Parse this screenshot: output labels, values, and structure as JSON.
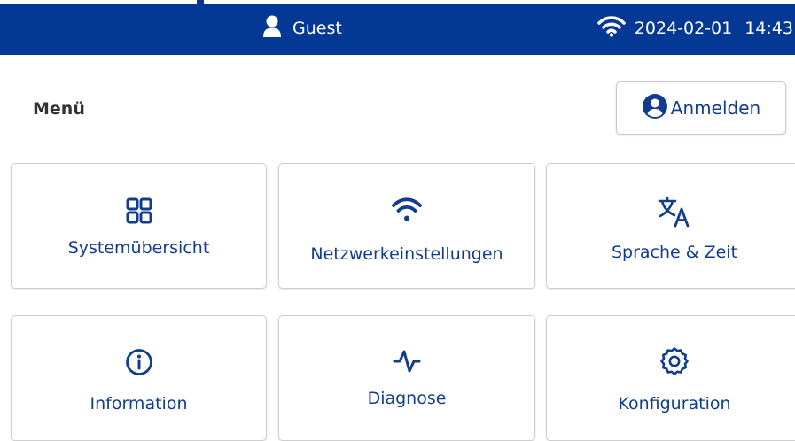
{
  "header": {
    "user_name": "Guest",
    "date": "2024-02-01",
    "time": "14:43",
    "background_color": "#043895"
  },
  "menu": {
    "title": "Menü",
    "login_label": "Anmelden"
  },
  "tiles": [
    {
      "label": "Systemübersicht",
      "icon": "grid-icon"
    },
    {
      "label": "Netzwerkeinstellungen",
      "icon": "wifi-icon"
    },
    {
      "label": "Sprache & Zeit",
      "icon": "translate-icon"
    },
    {
      "label": "Information",
      "icon": "info-icon"
    },
    {
      "label": "Diagnose",
      "icon": "pulse-icon"
    },
    {
      "label": "Konfiguration",
      "icon": "gear-icon"
    }
  ],
  "colors": {
    "accent": "#123d8f",
    "header": "#043895"
  }
}
